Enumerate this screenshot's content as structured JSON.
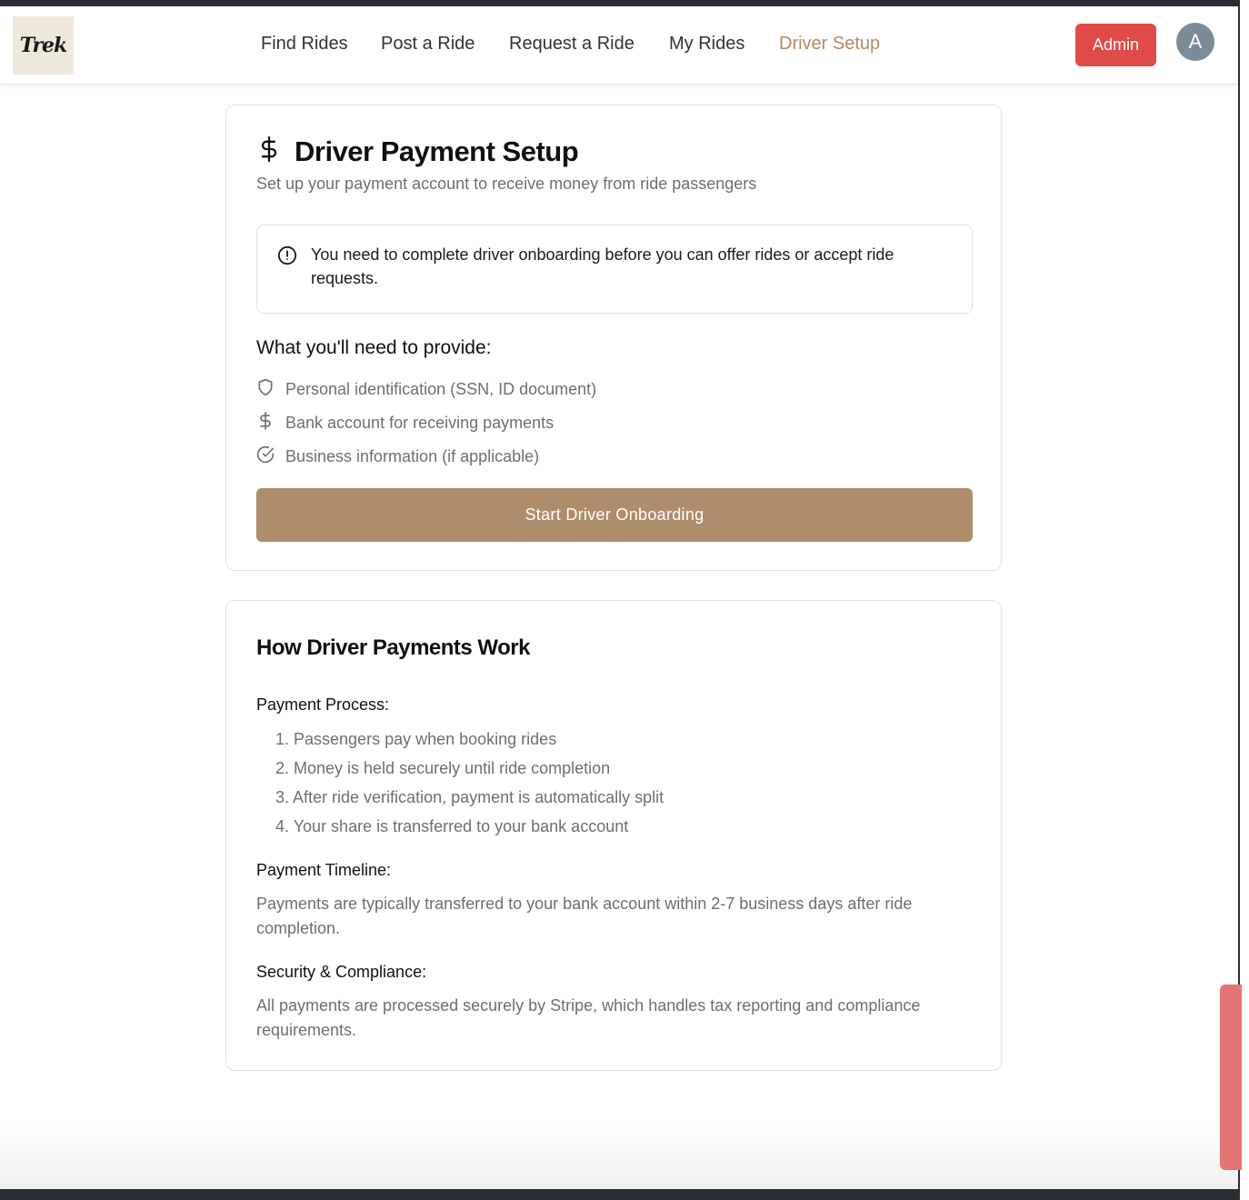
{
  "header": {
    "logo_text": "Trek",
    "nav": [
      {
        "label": "Find Rides"
      },
      {
        "label": "Post a Ride"
      },
      {
        "label": "Request a Ride"
      },
      {
        "label": "My Rides"
      },
      {
        "label": "Driver Setup",
        "active": true
      }
    ],
    "admin_label": "Admin",
    "avatar_initial": "A"
  },
  "setup_card": {
    "title": "Driver Payment Setup",
    "subtitle": "Set up your payment account to receive money from ride passengers",
    "alert": "You need to complete driver onboarding before you can offer rides or accept ride requests.",
    "needs_heading": "What you'll need to provide:",
    "requirements": [
      {
        "icon": "shield-icon",
        "label": "Personal identification (SSN, ID document)"
      },
      {
        "icon": "dollar-icon",
        "label": "Bank account for receiving payments"
      },
      {
        "icon": "check-circle-icon",
        "label": "Business information (if applicable)"
      }
    ],
    "button_label": "Start Driver Onboarding"
  },
  "info_card": {
    "title": "How Driver Payments Work",
    "process_heading": "Payment Process:",
    "steps": [
      "1. Passengers pay when booking rides",
      "2. Money is held securely until ride completion",
      "3. After ride verification, payment is automatically split",
      "4. Your share is transferred to your bank account"
    ],
    "timeline_heading": "Payment Timeline:",
    "timeline_text": "Payments are typically transferred to your bank account within 2-7 business days after ride completion.",
    "security_heading": "Security & Compliance:",
    "security_text": "All payments are processed securely by Stripe, which handles tax reporting and compliance requirements."
  },
  "colors": {
    "accent": "#ae8d6b",
    "active_nav": "#b08b62",
    "admin": "#e04b4a"
  }
}
